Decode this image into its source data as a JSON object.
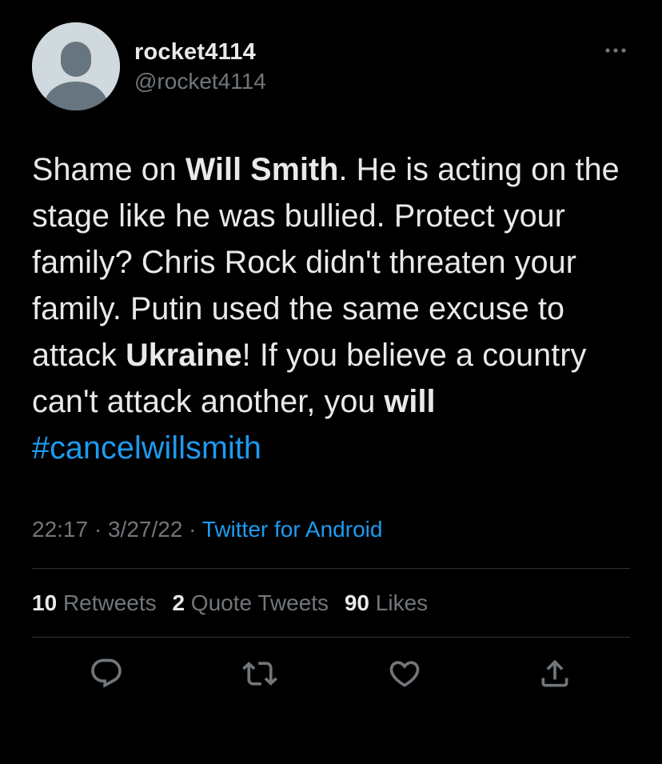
{
  "user": {
    "display_name": "rocket4114",
    "handle": "@rocket4114"
  },
  "tweet": {
    "segments": [
      {
        "text": "Shame on ",
        "style": "normal"
      },
      {
        "text": "Will Smith",
        "style": "bold"
      },
      {
        "text": ". He is acting on the stage like he was bullied. Protect your family? Chris Rock didn't threaten your family. Putin used the same excuse to attack ",
        "style": "normal"
      },
      {
        "text": "Ukraine",
        "style": "bold"
      },
      {
        "text": "! If you believe a country can't attack another, you ",
        "style": "normal"
      },
      {
        "text": "will",
        "style": "bold"
      },
      {
        "text": " ",
        "style": "normal"
      },
      {
        "text": "#cancelwillsmith",
        "style": "hashtag"
      }
    ]
  },
  "meta": {
    "time": "22:17",
    "separator": "·",
    "date": "3/27/22",
    "source": "Twitter for Android"
  },
  "stats": {
    "retweets_count": "10",
    "retweets_label": "Retweets",
    "quotes_count": "2",
    "quotes_label": "Quote Tweets",
    "likes_count": "90",
    "likes_label": "Likes"
  },
  "actions": {
    "reply": "reply-icon",
    "retweet": "retweet-icon",
    "like": "heart-icon",
    "share": "share-icon"
  },
  "colors": {
    "background": "#000000",
    "text": "#e7e9ea",
    "secondary": "#71767b",
    "accent": "#1d9bf0",
    "divider": "#2f3336"
  }
}
